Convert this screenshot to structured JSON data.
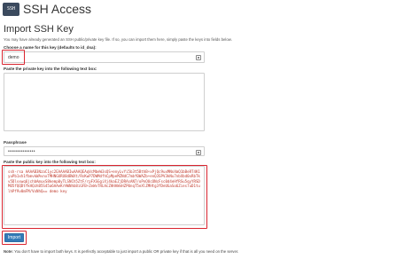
{
  "header": {
    "logo_text": "SSH",
    "title": "SSH Access"
  },
  "import": {
    "title": "Import SSH Key",
    "intro": "You may have already generated an SSH public/private key file. If so, you can import them here, simply paste the keys into fields below.",
    "keyname_label": "Choose a name for this key (defaults to id_dsa):",
    "keyname_value": "demo",
    "private_label": "Paste the private key into the following text box:",
    "private_value": "",
    "passphrase_label": "Passphrase",
    "passphrase_value": "•••••••••••••••",
    "public_label": "Paste the public key into the following text box:",
    "public_value": "ssh-rsa AAAAB3NzaC1yc2EAAAABIwAAAQEAqVcMbeW3sQS+enyLvYi5b3t5BthB+xPjQc9uxMNnXmQ1bBeRT4K1yuPb1xh1fbmvkWAvnxTMHNGURU8dBWXt/RsKwP7DWMdfhCpMpeMZNdC7mbf0WAZb+enQ3SPV3kNu7nbXbd0xRbTkv5Dlvxwq6jchbAmuxS8kemp0yTLSNCh5ZtF/rpFXSGgiXj4kaEZjDRAsAN7/oPnOUcONcFsc0d4eHfRSu5qyYRSDMO5fQQDtfkHQzhB5S45a6AAeKrHWNhb8iGFB+ZeWvTRLHcZHHAWnHZP0nqT5eXlZMHtg3fDeUGaSo6Zies7uD1tulhPf9v0mFM/VxNhQ== demo key",
    "import_button": "Import",
    "note_prefix": "Note:",
    "note_text": "You don't have to import both keys. It is perfectly acceptable to just import a public OR private key if that is all you need on the server."
  }
}
